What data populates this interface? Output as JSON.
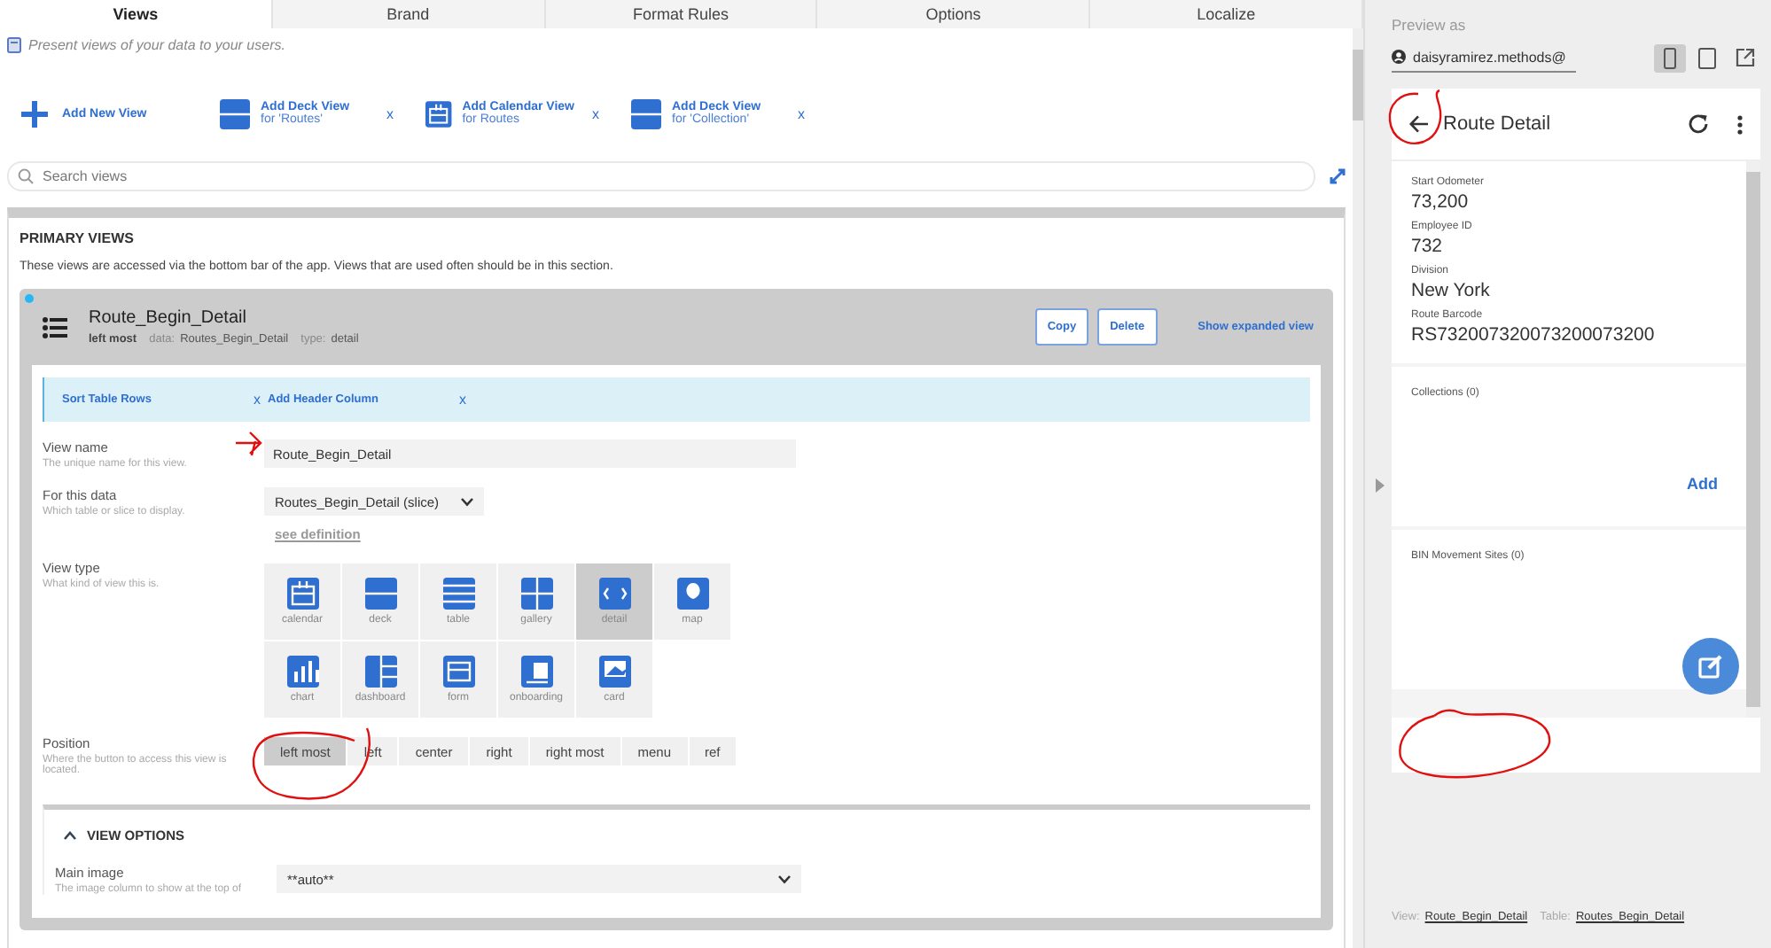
{
  "tabs": [
    {
      "label": "Views",
      "selected": true
    },
    {
      "label": "Brand",
      "selected": false
    },
    {
      "label": "Format Rules",
      "selected": false
    },
    {
      "label": "Options",
      "selected": false
    },
    {
      "label": "Localize",
      "selected": false
    }
  ],
  "intro": "Present views of your data to your users.",
  "add_actions": [
    {
      "kind": "new",
      "title": "Add New View"
    },
    {
      "kind": "deck",
      "title": "Add Deck View",
      "subtitle": "for 'Routes'",
      "dismiss": "x"
    },
    {
      "kind": "calendar",
      "title": "Add Calendar View",
      "subtitle": "for Routes",
      "dismiss": "x"
    },
    {
      "kind": "deck",
      "title": "Add Deck View",
      "subtitle": "for 'Collection'",
      "dismiss": "x"
    }
  ],
  "search": {
    "placeholder": "Search views"
  },
  "section": {
    "title": "PRIMARY VIEWS",
    "description": "These views are accessed via the bottom bar of the app. Views that are used often should be in this section."
  },
  "view_card": {
    "title": "Route_Begin_Detail",
    "position": "left most",
    "data_label": "data:",
    "data_value": "Routes_Begin_Detail",
    "type_label": "type:",
    "type_value": "detail",
    "buttons": [
      "Copy",
      "Delete"
    ],
    "link": "Show expanded view",
    "suggestions": [
      {
        "label": "Sort Table Rows",
        "dismiss": "x"
      },
      {
        "label": "Add Header Column",
        "dismiss": "x"
      }
    ],
    "view_name": {
      "label": "View name",
      "hint": "The unique name for this view.",
      "value": "Route_Begin_Detail"
    },
    "data": {
      "label": "For this data",
      "hint": "Which table or slice to display.",
      "value": "Routes_Begin_Detail (slice)",
      "link": "see definition"
    },
    "view_type": {
      "label": "View type",
      "hint": "What kind of view this is.",
      "options": [
        {
          "kind": "calendar",
          "label": "calendar",
          "selected": false
        },
        {
          "kind": "deck",
          "label": "deck",
          "selected": false
        },
        {
          "kind": "table",
          "label": "table",
          "selected": false
        },
        {
          "kind": "gallery",
          "label": "gallery",
          "selected": false
        },
        {
          "kind": "detail",
          "label": "detail",
          "selected": true
        },
        {
          "kind": "map",
          "label": "map",
          "selected": false
        },
        {
          "kind": "chart",
          "label": "chart",
          "selected": false
        },
        {
          "kind": "dashboard",
          "label": "dashboard",
          "selected": false
        },
        {
          "kind": "form",
          "label": "form",
          "selected": false
        },
        {
          "kind": "onboarding",
          "label": "onboarding",
          "selected": false
        },
        {
          "kind": "card",
          "label": "card",
          "selected": false
        }
      ]
    },
    "position_field": {
      "label": "Position",
      "hint": "Where the button to access this view is located.",
      "options": [
        {
          "label": "left most",
          "selected": true
        },
        {
          "label": "left",
          "selected": false
        },
        {
          "label": "center",
          "selected": false
        },
        {
          "label": "right",
          "selected": false
        },
        {
          "label": "right most",
          "selected": false
        },
        {
          "label": "menu",
          "selected": false
        },
        {
          "label": "ref",
          "selected": false
        }
      ]
    },
    "view_options": {
      "title": "VIEW OPTIONS",
      "expanded": true,
      "main_image": {
        "label": "Main image",
        "hint": "The image column to show at the top of",
        "value": "**auto**"
      }
    }
  },
  "preview": {
    "label": "Preview as",
    "user": "daisyramirez.methods@",
    "devices": [
      {
        "kind": "phone",
        "selected": true
      },
      {
        "kind": "tablet",
        "selected": false
      }
    ],
    "app": {
      "title": "Route Detail",
      "fields": [
        {
          "label": "Start Odometer",
          "value": "73,200"
        },
        {
          "label": "Employee ID",
          "value": "732"
        },
        {
          "label": "Division",
          "value": "New York"
        },
        {
          "label": "Route Barcode",
          "value": "RS732007320073200073200"
        }
      ],
      "sections": [
        {
          "title": "Collections (0)",
          "action": "Add"
        },
        {
          "title": "BIN Movement Sites (0)"
        }
      ]
    },
    "footer": {
      "view_label": "View:",
      "view_value": "Route_Begin_Detail",
      "table_label": "Table:",
      "table_value": "Routes_Begin_Detail"
    }
  }
}
